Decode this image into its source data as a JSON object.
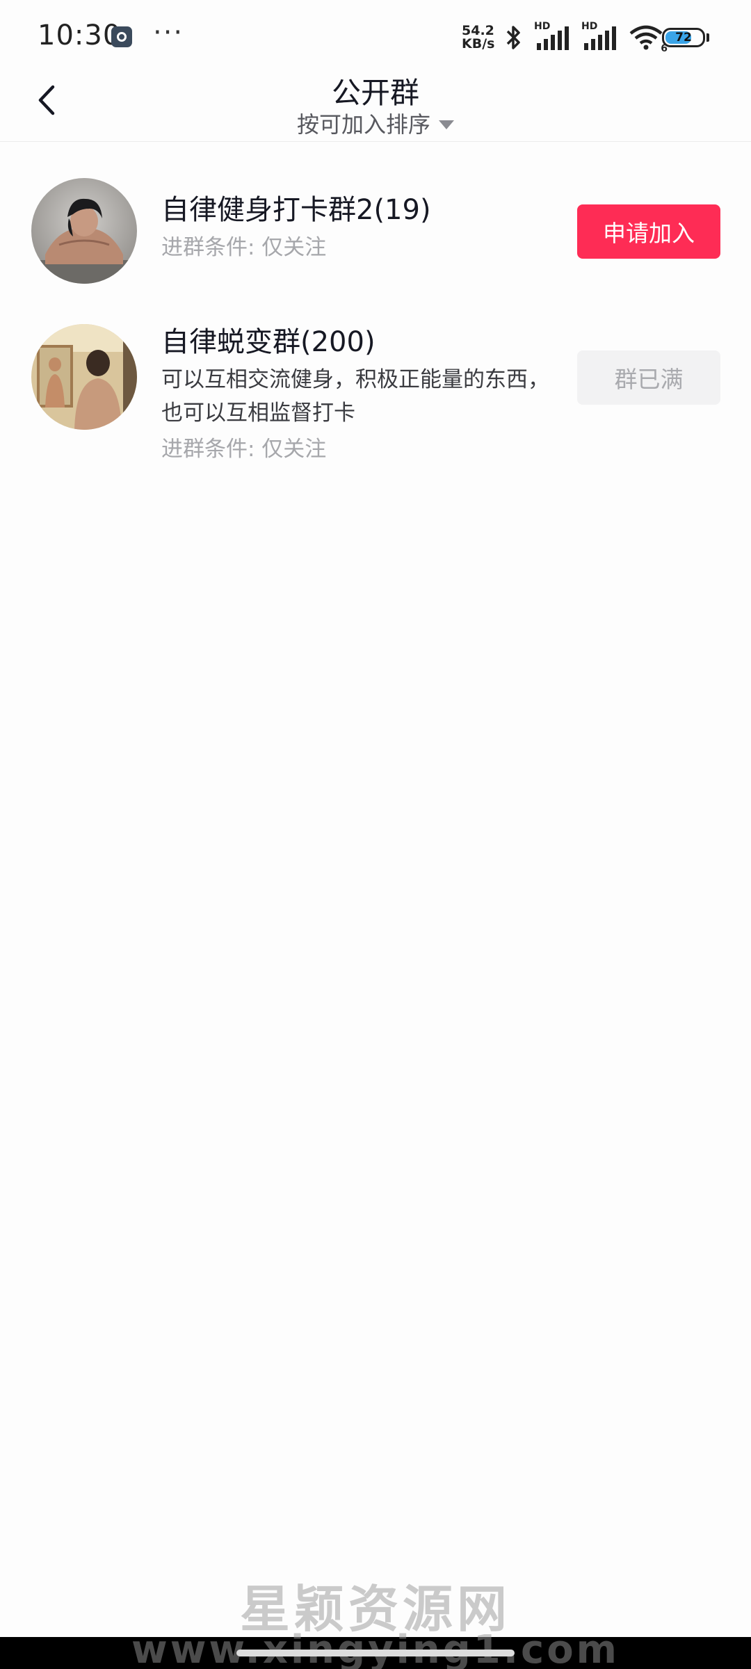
{
  "status_bar": {
    "time": "10:30",
    "dots": "···",
    "net_speed_value": "54.2",
    "net_speed_unit": "KB/s",
    "signal_1_label": "HD",
    "signal_2_label": "HD",
    "wifi_badge": "6",
    "battery": "72",
    "battery_level": 0.72
  },
  "nav": {
    "title": "公开群",
    "sort_label": "按可加入排序"
  },
  "groups": [
    {
      "name": "自律健身打卡群2(19)",
      "description": "",
      "condition": "进群条件: 仅关注",
      "action": "申请加入",
      "action_state": "join"
    },
    {
      "name": "自律蜕变群(200)",
      "description": "可以互相交流健身，积极正能量的东西，也可以互相监督打卡",
      "condition": "进群条件: 仅关注",
      "action": "群已满",
      "action_state": "full"
    }
  ],
  "watermark": {
    "title": "星颖资源网",
    "url": "www.xingying1.com"
  },
  "colors": {
    "accent": "#fe2c55",
    "disabled_bg": "#f2f2f3",
    "disabled_text": "#a9aaae",
    "secondary_text": "#a6a7ab"
  }
}
